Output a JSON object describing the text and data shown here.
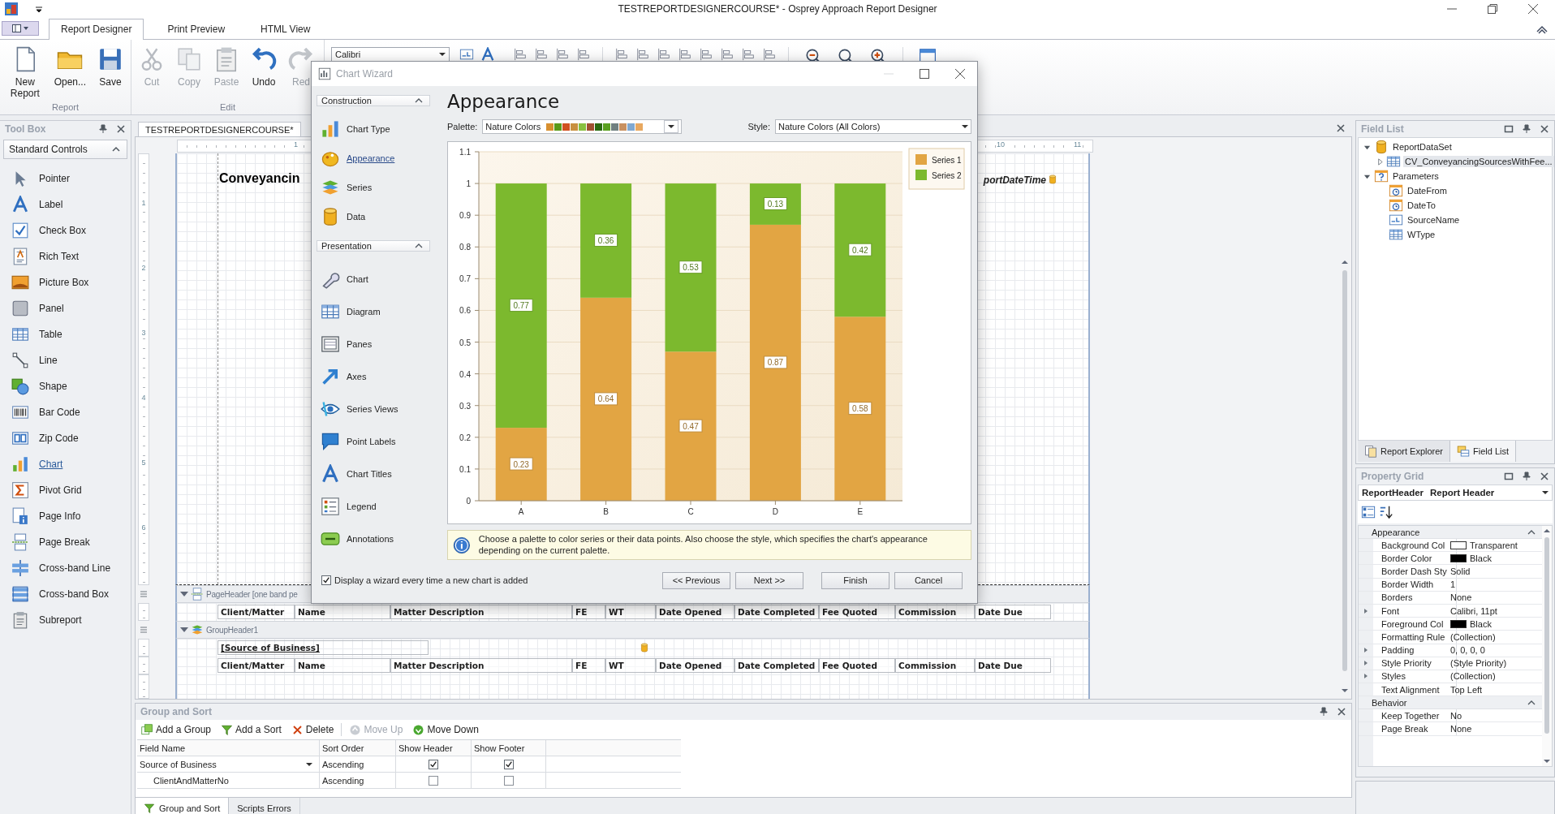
{
  "app": {
    "title": "TESTREPORTDESIGNERCOURSE* - Osprey Approach Report Designer"
  },
  "ribbon": {
    "tabs": [
      {
        "label": "Report Designer",
        "selected": true
      },
      {
        "label": "Print Preview",
        "selected": false
      },
      {
        "label": "HTML View",
        "selected": false
      }
    ],
    "groups": [
      {
        "label": "Report",
        "buttons": [
          {
            "label": "New Report",
            "disabled": false
          },
          {
            "label": "Open...",
            "disabled": false
          },
          {
            "label": "Save",
            "disabled": false
          }
        ]
      },
      {
        "label": "Edit",
        "buttons": [
          {
            "label": "Cut",
            "disabled": true
          },
          {
            "label": "Copy",
            "disabled": true
          },
          {
            "label": "Paste",
            "disabled": true
          },
          {
            "label": "Undo",
            "disabled": false
          },
          {
            "label": "Red",
            "disabled": true
          }
        ]
      }
    ],
    "font": {
      "value": "Calibri"
    }
  },
  "toolbox": {
    "title": "Tool Box",
    "category": "Standard Controls",
    "items": [
      {
        "label": "Pointer",
        "highlighted": false
      },
      {
        "label": "Label",
        "highlighted": false
      },
      {
        "label": "Check Box",
        "highlighted": false
      },
      {
        "label": "Rich Text",
        "highlighted": false
      },
      {
        "label": "Picture Box",
        "highlighted": false
      },
      {
        "label": "Panel",
        "highlighted": false
      },
      {
        "label": "Table",
        "highlighted": false
      },
      {
        "label": "Line",
        "highlighted": false
      },
      {
        "label": "Shape",
        "highlighted": false
      },
      {
        "label": "Bar Code",
        "highlighted": false
      },
      {
        "label": "Zip Code",
        "highlighted": false
      },
      {
        "label": "Chart",
        "highlighted": true
      },
      {
        "label": "Pivot Grid",
        "highlighted": false
      },
      {
        "label": "Page Info",
        "highlighted": false
      },
      {
        "label": "Page Break",
        "highlighted": false
      },
      {
        "label": "Cross-band Line",
        "highlighted": false
      },
      {
        "label": "Cross-band Box",
        "highlighted": false
      },
      {
        "label": "Subreport",
        "highlighted": false
      }
    ]
  },
  "designer": {
    "tab": "TESTREPORTDESIGNERCOURSE*",
    "ruler": {
      "horizontal": [
        "1",
        "10",
        "11"
      ],
      "vertical": [
        "1",
        "2",
        "3",
        "4",
        "5",
        "6"
      ]
    },
    "report_title": "Conveyancin",
    "date_field": "portDateTime",
    "bands": [
      {
        "kind": "page-header",
        "label": "PageHeader [one band pe",
        "rows": [
          [
            "Client/Matter",
            "Name",
            "Matter Description",
            "FE",
            "WT",
            "Date Opened",
            "Date Completed",
            "Fee Quoted",
            "Commission",
            "Date Due"
          ]
        ]
      },
      {
        "kind": "group-header",
        "label": "GroupHeader1",
        "field": "[Source of Business]",
        "rows": [
          [
            "Client/Matter",
            "Name",
            "Matter Description",
            "FE",
            "WT",
            "Date Opened",
            "Date Completed",
            "Fee Quoted",
            "Commission",
            "Date Due"
          ]
        ]
      }
    ]
  },
  "chart_wizard": {
    "title": "Chart Wizard",
    "sections": [
      {
        "label": "Construction",
        "expanded": true,
        "items": [
          {
            "label": "Chart Type",
            "selected": false
          },
          {
            "label": "Appearance",
            "selected": true
          },
          {
            "label": "Series",
            "selected": false
          },
          {
            "label": "Data",
            "selected": false
          }
        ]
      },
      {
        "label": "Presentation",
        "expanded": true,
        "items": [
          {
            "label": "Chart",
            "selected": false
          },
          {
            "label": "Diagram",
            "selected": false
          },
          {
            "label": "Panes",
            "selected": false
          },
          {
            "label": "Axes",
            "selected": false
          },
          {
            "label": "Series Views",
            "selected": false
          },
          {
            "label": "Point Labels",
            "selected": false
          },
          {
            "label": "Chart Titles",
            "selected": false
          },
          {
            "label": "Legend",
            "selected": false
          },
          {
            "label": "Annotations",
            "selected": false
          }
        ]
      }
    ],
    "page_title": "Appearance",
    "palette": {
      "label": "Palette:",
      "value": "Nature Colors",
      "swatches": [
        {
          "color": "#d89030"
        },
        {
          "color": "#5a9a1a"
        },
        {
          "color": "#d05020"
        },
        {
          "color": "#c89040"
        },
        {
          "color": "#88c040"
        },
        {
          "color": "#a05030"
        },
        {
          "color": "#2a6a10"
        },
        {
          "color": "#5aa020"
        },
        {
          "color": "#708080"
        },
        {
          "color": "#c89060"
        },
        {
          "color": "#80a8d0"
        },
        {
          "color": "#e8a860"
        }
      ]
    },
    "style": {
      "label": "Style:",
      "value": "Nature Colors (All Colors)"
    },
    "chart_data": {
      "type": "bar",
      "stacked": true,
      "categories": [
        "A",
        "B",
        "C",
        "D",
        "E"
      ],
      "series": [
        {
          "name": "Series 1",
          "color": "#e2a543",
          "values": [
            0.23,
            0.64,
            0.47,
            0.87,
            0.58
          ]
        },
        {
          "name": "Series 2",
          "color": "#7cb92e",
          "values": [
            0.77,
            0.36,
            0.53,
            0.13,
            0.42
          ]
        }
      ],
      "ylim": [
        0,
        1.1
      ],
      "yticks": [
        0,
        0.1,
        0.2,
        0.3,
        0.4,
        0.5,
        0.6,
        0.7,
        0.8,
        0.9,
        1,
        1.1
      ],
      "data_labels": true,
      "grid": true,
      "legend": true
    },
    "hint": "Choose a palette to color series or their data points. Also choose the style, which specifies the chart's appearance depending on the current palette.",
    "show_wizard": {
      "label": "Display a wizard every time a new chart is added",
      "checked": true
    },
    "buttons": [
      {
        "label": "<< Previous"
      },
      {
        "label": "Next >>"
      },
      {
        "label": "Finish"
      },
      {
        "label": "Cancel"
      }
    ]
  },
  "field_list": {
    "title": "Field List",
    "tree": [
      {
        "kind": "dataset",
        "label": "ReportDataSet",
        "expanded": true,
        "selected": false,
        "children": [
          {
            "kind": "table",
            "label": "CV_ConveyancingSourcesWithFee...",
            "expanded": false,
            "selected": true
          }
        ]
      },
      {
        "kind": "parameters",
        "label": "Parameters",
        "expanded": true,
        "selected": false,
        "children": [
          {
            "kind": "date",
            "label": "DateFrom",
            "selected": false
          },
          {
            "kind": "date",
            "label": "DateTo",
            "selected": false
          },
          {
            "kind": "text",
            "label": "SourceName",
            "selected": false
          },
          {
            "kind": "table",
            "label": "WType",
            "selected": false
          }
        ]
      }
    ],
    "tabs": [
      {
        "label": "Report Explorer",
        "selected": false
      },
      {
        "label": "Field List",
        "selected": true
      }
    ]
  },
  "property_grid": {
    "title": "Property Grid",
    "object": "ReportHeader",
    "object_type": "Report Header",
    "categories": [
      {
        "label": "Appearance",
        "expanded": true,
        "properties": [
          {
            "name": "Background Col",
            "value": "Transparent",
            "color": "#ffffff",
            "expandable": false
          },
          {
            "name": "Border Color",
            "value": "Black",
            "color": "#000000",
            "expandable": false
          },
          {
            "name": "Border Dash Sty",
            "value": "Solid",
            "expandable": false
          },
          {
            "name": "Border Width",
            "value": "1",
            "expandable": false
          },
          {
            "name": "Borders",
            "value": "None",
            "expandable": false
          },
          {
            "name": "Font",
            "value": "Calibri, 11pt",
            "expandable": true
          },
          {
            "name": "Foreground Col",
            "value": "Black",
            "color": "#000000",
            "expandable": false
          },
          {
            "name": "Formatting Rule",
            "value": "(Collection)",
            "expandable": false
          },
          {
            "name": "Padding",
            "value": "0, 0, 0, 0",
            "expandable": true
          },
          {
            "name": "Style Priority",
            "value": "(Style Priority)",
            "expandable": true
          },
          {
            "name": "Styles",
            "value": "(Collection)",
            "expandable": true
          },
          {
            "name": "Text Alignment",
            "value": "Top Left",
            "expandable": false
          }
        ]
      },
      {
        "label": "Behavior",
        "expanded": true,
        "properties": [
          {
            "name": "Keep Together",
            "value": "No",
            "expandable": false
          },
          {
            "name": "Page Break",
            "value": "None",
            "expandable": false
          }
        ]
      }
    ]
  },
  "group_sort": {
    "title": "Group and Sort",
    "toolbar": [
      {
        "label": "Add a Group",
        "disabled": false
      },
      {
        "label": "Add a Sort",
        "disabled": false
      },
      {
        "label": "Delete",
        "disabled": false
      },
      {
        "label": "Move Up",
        "disabled": true
      },
      {
        "label": "Move Down",
        "disabled": false
      }
    ],
    "columns": [
      "Field Name",
      "Sort Order",
      "Show Header",
      "Show Footer"
    ],
    "rows": [
      {
        "field": "Source of Business",
        "sort": "Ascending",
        "show_header": true,
        "show_footer": true,
        "children": [
          {
            "field": "ClientAndMatterNo",
            "sort": "Ascending",
            "show_header": false,
            "show_footer": false
          }
        ]
      }
    ]
  },
  "bottom_tabs": [
    {
      "label": "Group and Sort",
      "selected": true
    },
    {
      "label": "Scripts Errors",
      "selected": false
    }
  ]
}
